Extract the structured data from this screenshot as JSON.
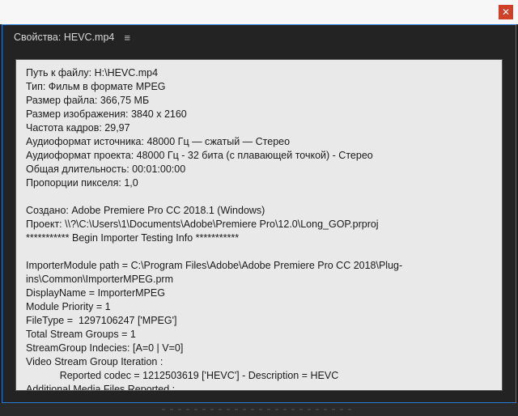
{
  "topbar": {
    "close_glyph": "✕"
  },
  "panel": {
    "title": "Свойства: HEVC.mp4",
    "menu_glyph": "≡"
  },
  "properties": {
    "lines": [
      "Путь к файлу: H:\\HEVC.mp4",
      "Тип: Фильм в формате MPEG",
      "Размер файла: 366,75 МБ",
      "Размер изображения: 3840 x 2160",
      "Частота кадров: 29,97",
      "Аудиоформат источника: 48000 Гц — сжатый — Стерео",
      "Аудиоформат проекта: 48000 Гц - 32 бита (с плавающей точкой) - Стерео",
      "Общая длительность: 00:01:00:00",
      "Пропорции пикселя: 1,0",
      "",
      "Создано: Adobe Premiere Pro CC 2018.1 (Windows)",
      "Проект: \\\\?\\C:\\Users\\1\\Documents\\Adobe\\Premiere Pro\\12.0\\Long_GOP.prproj",
      "*********** Begin Importer Testing Info ***********",
      "",
      "ImporterModule path = C:\\Program Files\\Adobe\\Adobe Premiere Pro CC 2018\\Plug-ins\\Common\\ImporterMPEG.prm",
      "DisplayName = ImporterMPEG",
      "Module Priority = 1",
      "FileType =  1297106247 ['MPEG']",
      "Total Stream Groups = 1",
      "StreamGroup Indecies: [A=0 | V=0]",
      "Video Stream Group Iteration :",
      "            Reported codec = 1212503619 ['HEVC'] - Description = HEVC",
      "Additional Media Files Reported :"
    ]
  }
}
